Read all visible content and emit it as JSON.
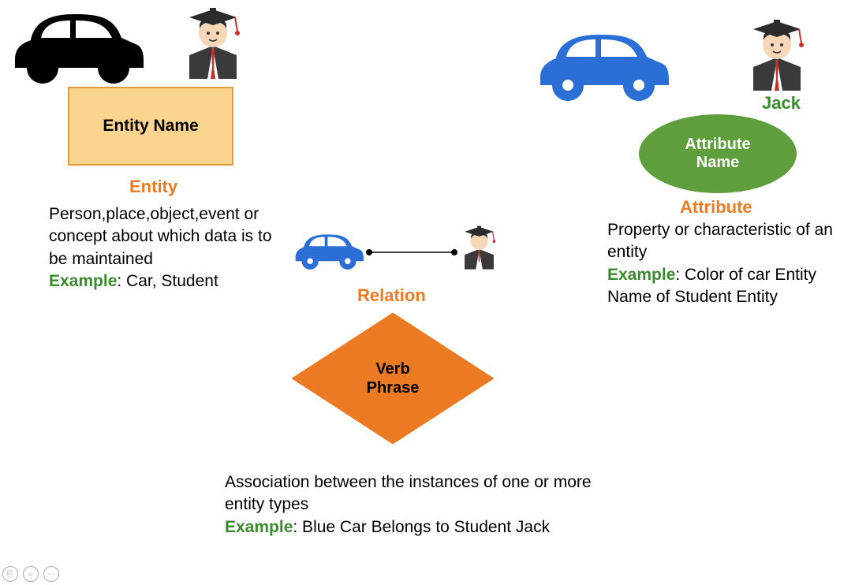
{
  "entity": {
    "box_label": "Entity Name",
    "title": "Entity",
    "desc": "Person,place,object,event or concept about which data is to be maintained",
    "example_label": "Example",
    "example_text": ": Car, Student"
  },
  "attribute": {
    "oval_label": "Attribute Name",
    "title": "Attribute",
    "jack_label": "Jack",
    "desc": "Property or characteristic of an entity",
    "example_label": "Example",
    "example_text": ": Color of car Entity Name of Student Entity"
  },
  "relation": {
    "diamond_label": "Verb Phrase",
    "title": "Relation",
    "desc": "Association between the instances of one or more entity types",
    "example_label": "Example",
    "example_text": ": Blue Car Belongs to Student Jack"
  },
  "toolbar": {
    "btn1": "⎘",
    "btn2": "⌕",
    "btn3": "⋯"
  }
}
